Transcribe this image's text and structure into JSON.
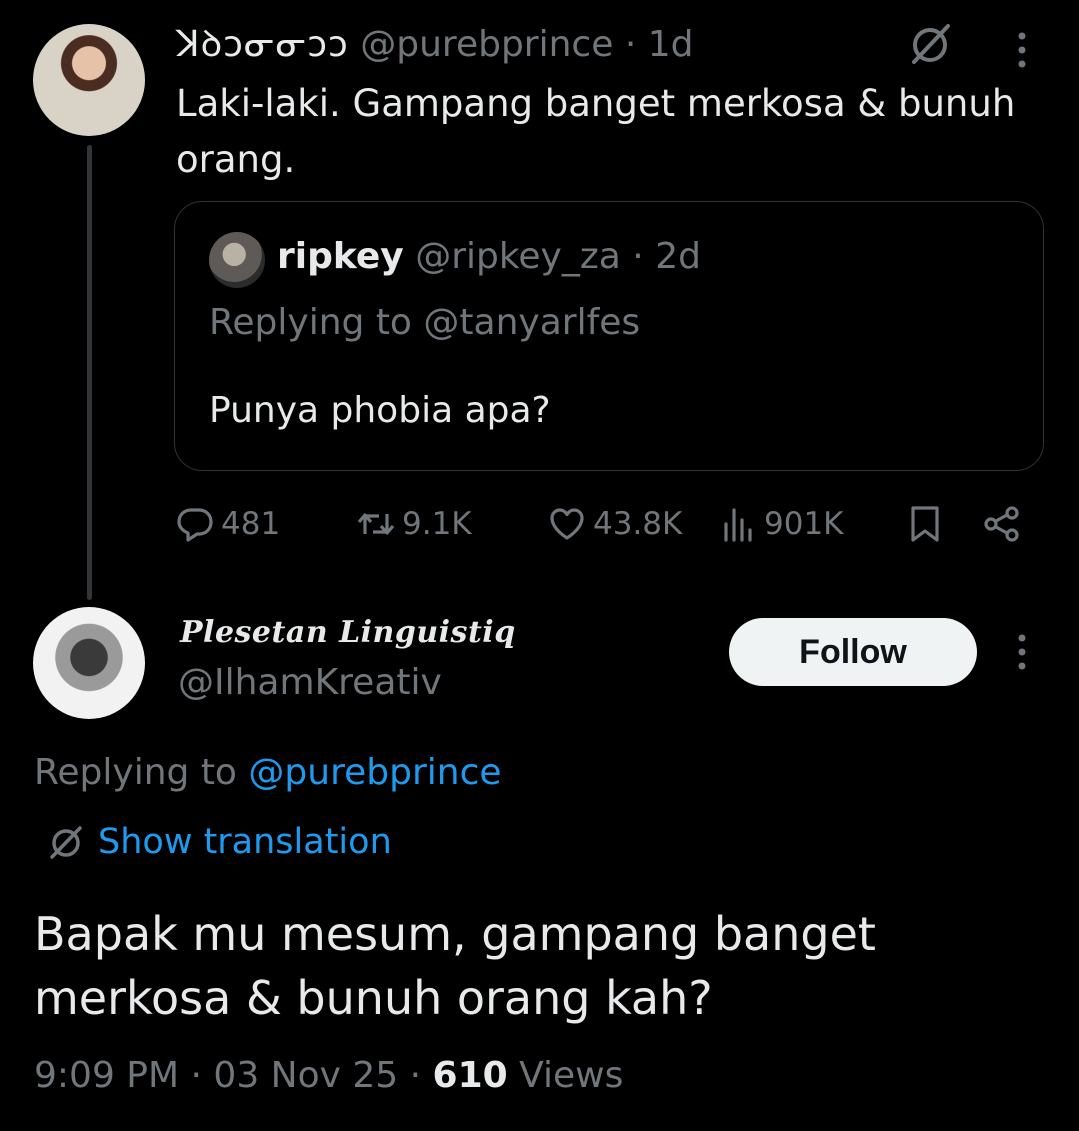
{
  "parent_tweet": {
    "author_name": "ꓘꝺɔᓂᓂɔɔ",
    "handle": "@purebprince",
    "time": "1d",
    "text": "Laki-laki. Gampang banget merkosa & bunuh orang.",
    "quoted_tweet": {
      "author_name": "ripkey",
      "handle": "@ripkey_za",
      "time": "2d",
      "replying_to_label": "Replying to",
      "replying_to_handle": "@tanyarlfes",
      "text": "Punya phobia apa?"
    },
    "actions": {
      "replies": "481",
      "retweets": "9.1K",
      "likes": "43.8K",
      "views": "901K"
    }
  },
  "reply_tweet": {
    "author_name": "Plesetan Linguistiq",
    "handle": "@IlhamKreativ",
    "follow_label": "Follow",
    "replying_to_label": "Replying to",
    "replying_to_handle": "@purebprince",
    "show_translation_label": "Show translation",
    "text": "Bapak mu mesum, gampang banget merkosa & bunuh orang kah?",
    "time": "9:09 PM",
    "date": "03 Nov 25",
    "views_count": "610",
    "views_label": "Views"
  },
  "icons": {
    "translate": "translate-icon",
    "more": "more-vertical-icon",
    "reply": "reply-icon",
    "retweet": "retweet-icon",
    "like": "heart-icon",
    "views": "views-chart-icon",
    "bookmark": "bookmark-icon",
    "share": "share-icon"
  },
  "colors": {
    "background": "#000000",
    "text": "#e7e9ea",
    "muted": "#71767b",
    "link": "#1d9bf0",
    "follow_bg": "#eff3f4"
  }
}
